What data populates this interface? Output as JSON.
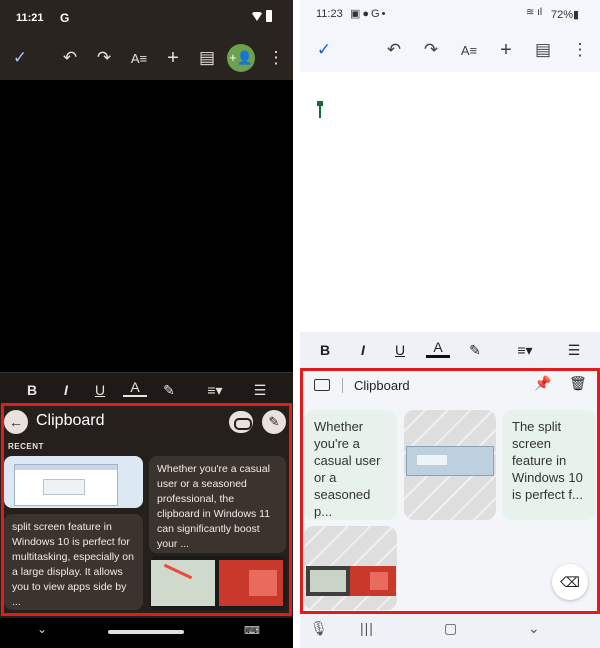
{
  "left": {
    "status": {
      "time": "11:21",
      "g": "G"
    },
    "toolbar": {
      "check": "✓",
      "undo": "↶",
      "redo": "↷",
      "text_format": "A≡",
      "add": "+",
      "comment": "▤",
      "share": "+👤",
      "more": "⋮"
    },
    "format": {
      "bold": "B",
      "italic": "I",
      "underline": "U",
      "text_color": "A",
      "highlight": "✎",
      "align": "≡▾",
      "list": "☰"
    },
    "clipboard": {
      "back": "←",
      "title": "Clipboard",
      "edit": "✎",
      "recent_label": "RECENT",
      "text_item_1": "Whether you're a casual user or a seasoned professional, the clipboard in Windows 11 can significantly boost your ...",
      "text_item_2": " split screen feature in Windows 10 is perfect for multitasking, especially on a large display. It allows you to view apps side by ..."
    },
    "nav": {
      "chevron": "⌄",
      "keyboard": "⌨"
    }
  },
  "right": {
    "status": {
      "time": "11:23",
      "icons": "▣●G•",
      "signal": "≋ ıl",
      "battery": "72%▮"
    },
    "toolbar": {
      "check": "✓",
      "undo": "↶",
      "redo": "↷",
      "text_format": "A≡",
      "add": "+",
      "comment": "▤",
      "more": "⋮"
    },
    "format": {
      "bold": "B",
      "italic": "I",
      "underline": "U",
      "text_color": "A",
      "highlight": "✎",
      "align": "≡▾",
      "list": "☰"
    },
    "clipboard": {
      "title": "Clipboard",
      "pin": "📌",
      "trash": "🗑",
      "text_item_1": "Whether you're a casual user or a seasoned p...",
      "text_item_2": "The split screen feature in Windows 10 is perfect f...",
      "backspace": "⌫"
    },
    "nav": {
      "mic": "🎙",
      "recents": "|||",
      "home": "▢",
      "back": "⌄"
    }
  }
}
